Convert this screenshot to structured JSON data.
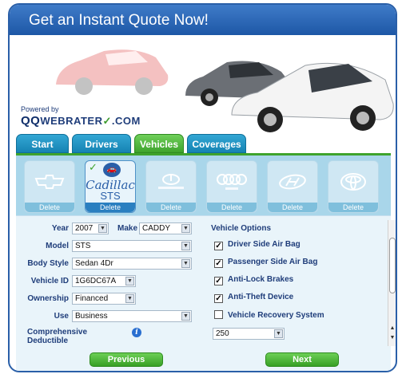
{
  "header": {
    "title": "Get an Instant Quote Now!"
  },
  "brand": {
    "powered_by": "Powered by",
    "qq": "QQ",
    "name": "WEBRATER",
    "check": "✓",
    "suffix": ".COM"
  },
  "tabs": [
    {
      "label": "Start",
      "active": false
    },
    {
      "label": "Drivers",
      "active": false
    },
    {
      "label": "Vehicles",
      "active": true
    },
    {
      "label": "Coverages",
      "active": false
    }
  ],
  "vehicles": [
    {
      "make": "Chevrolet",
      "logo": "chevrolet-logo-icon",
      "sub": "",
      "selected": false,
      "delete": "Delete"
    },
    {
      "make": "Cadillac",
      "logo": "cadillac-logo-icon",
      "sub": "STS",
      "selected": true,
      "delete": "Delete",
      "check": "✓"
    },
    {
      "make": "INFINITI",
      "logo": "infiniti-logo-icon",
      "sub": "",
      "selected": false,
      "delete": "Delete"
    },
    {
      "make": "Audi",
      "logo": "audi-logo-icon",
      "sub": "",
      "selected": false,
      "delete": "Delete"
    },
    {
      "make": "Hyundai",
      "logo": "hyundai-logo-icon",
      "sub": "",
      "selected": false,
      "delete": "Delete"
    },
    {
      "make": "Toyota",
      "logo": "toyota-logo-icon",
      "sub": "",
      "selected": false,
      "delete": "Delete"
    }
  ],
  "form": {
    "year": {
      "label": "Year",
      "value": "2007"
    },
    "make": {
      "label": "Make",
      "value": "CADDY"
    },
    "model": {
      "label": "Model",
      "value": "STS"
    },
    "body_style": {
      "label": "Body Style",
      "value": "Sedan 4Dr"
    },
    "vehicle_id": {
      "label": "Vehicle ID",
      "value": "1G6DC67A"
    },
    "ownership": {
      "label": "Ownership",
      "value": "Financed"
    },
    "use": {
      "label": "Use",
      "value": "Business"
    },
    "comprehensive": {
      "label": "Comprehensive Deductible",
      "value": "250"
    }
  },
  "options": {
    "title": "Vehicle Options",
    "items": [
      {
        "label": "Driver Side Air Bag",
        "checked": true
      },
      {
        "label": "Passenger Side Air Bag",
        "checked": true
      },
      {
        "label": "Anti-Lock Brakes",
        "checked": true
      },
      {
        "label": "Anti-Theft Device",
        "checked": true
      },
      {
        "label": "Vehicle Recovery System",
        "checked": false
      }
    ]
  },
  "buttons": {
    "previous": "Previous",
    "next": "Next"
  },
  "colors": {
    "header": "#2a5fa8",
    "tab": "#1683b3",
    "tab_active": "#3ea32c",
    "button": "#37a025"
  }
}
